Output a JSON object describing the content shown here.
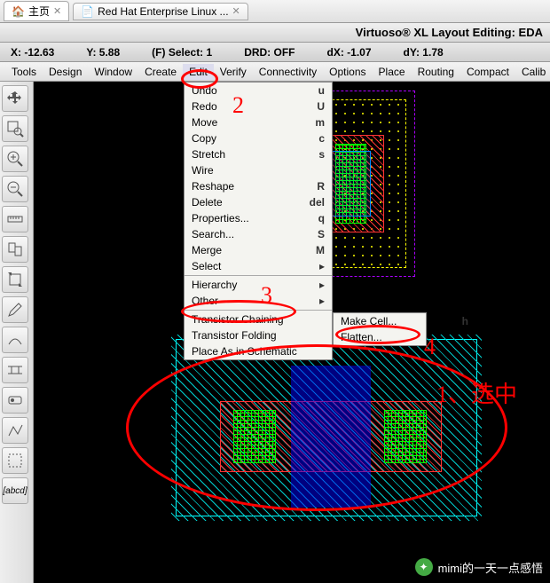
{
  "tabs": [
    {
      "label": "主页",
      "icon": "home"
    },
    {
      "label": "Red Hat Enterprise Linux ...",
      "icon": "page"
    }
  ],
  "title": "Virtuoso® XL Layout Editing: EDA",
  "status": {
    "x": "X: -12.63",
    "y": "Y: 5.88",
    "select": "(F) Select: 1",
    "drd": "DRD: OFF",
    "dx": "dX: -1.07",
    "dy": "dY: 1.78"
  },
  "menus": [
    "Tools",
    "Design",
    "Window",
    "Create",
    "Edit",
    "Verify",
    "Connectivity",
    "Options",
    "Place",
    "Routing",
    "Compact",
    "Calib"
  ],
  "edit_menu": [
    {
      "label": "Undo",
      "key": "u"
    },
    {
      "label": "Redo",
      "key": "U"
    },
    {
      "label": "Move",
      "key": "m"
    },
    {
      "label": "Copy",
      "key": "c"
    },
    {
      "label": "Stretch",
      "key": "s"
    },
    {
      "label": "Wire",
      "key": ""
    },
    {
      "label": "Reshape",
      "key": "R"
    },
    {
      "label": "Delete",
      "key": "del"
    },
    {
      "label": "Properties...",
      "key": "q"
    },
    {
      "label": "Search...",
      "key": "S"
    },
    {
      "label": "Merge",
      "key": "M"
    },
    {
      "label": "Select",
      "key": "",
      "sub": true,
      "sep_after": true
    },
    {
      "label": "Hierarchy",
      "key": "",
      "sub": true
    },
    {
      "label": "Other",
      "key": "",
      "sub": true,
      "sep_after": true
    },
    {
      "label": "Transistor Chaining",
      "key": ""
    },
    {
      "label": "Transistor Folding",
      "key": ""
    },
    {
      "label": "Place As in Schematic",
      "key": ""
    }
  ],
  "hierarchy_submenu": [
    {
      "label": "Make Cell...",
      "key": "h"
    },
    {
      "label": "Flatten...",
      "key": ""
    }
  ],
  "annotations": {
    "n1": "1、选中",
    "n2": "2",
    "n3": "3",
    "n4": "4"
  },
  "toolbox_names": [
    "arrows",
    "rect-zoom",
    "zoom-in",
    "zoom-out",
    "ruler",
    "pages",
    "stretch",
    "pencil",
    "wire-arc",
    "split-h",
    "toggle",
    "path",
    "select-box",
    "abcd-label"
  ],
  "watermark": "mimi的一天一点感悟",
  "abcd": "[abcd]"
}
